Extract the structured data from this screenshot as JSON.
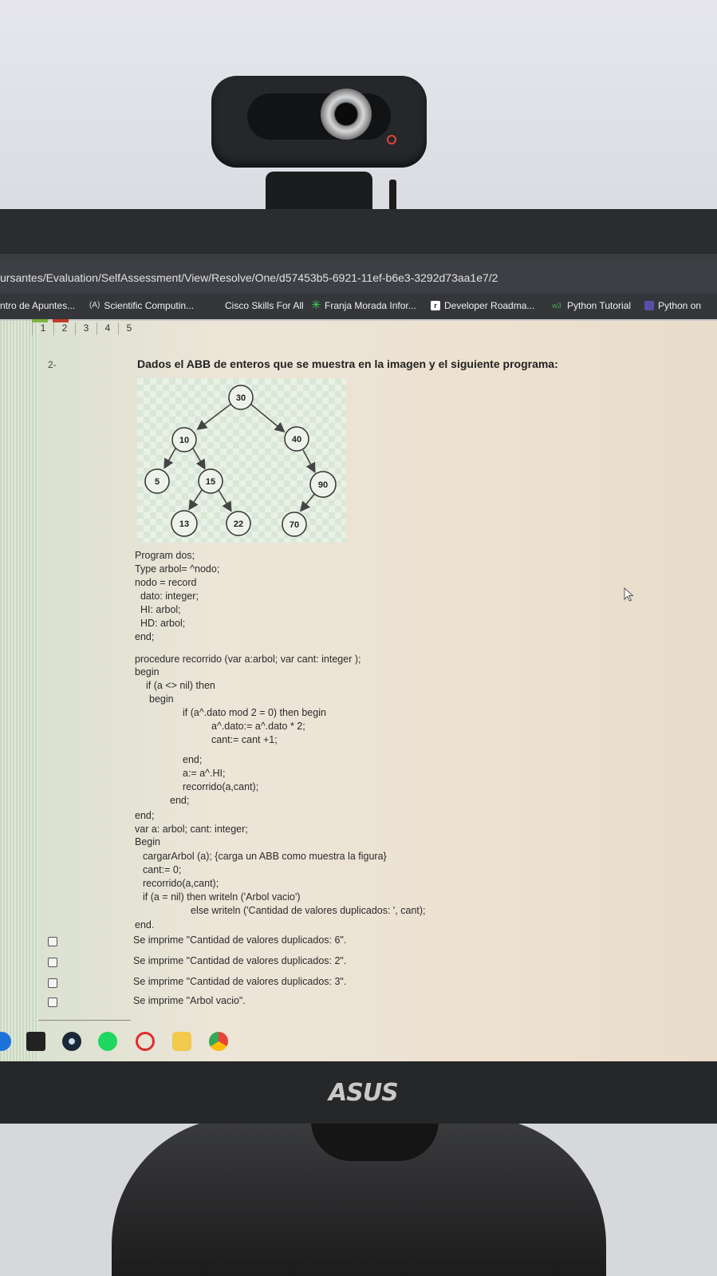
{
  "browser": {
    "url": "ursantes/Evaluation/SelfAssessment/View/Resolve/One/d57453b5-6921-11ef-b6e3-3292d73aa1e7/2",
    "bookmarks": [
      {
        "label": "ntro de Apuntes...",
        "icon": ""
      },
      {
        "label": "Scientific Computin...",
        "icon": "(A)"
      },
      {
        "label": "Cisco Skills For All",
        "icon": ""
      },
      {
        "label": "Franja Morada Infor...",
        "icon": "star-icon"
      },
      {
        "label": "Developer Roadma...",
        "icon": "r"
      },
      {
        "label": "Python Tutorial",
        "icon": "w3"
      },
      {
        "label": "Python on",
        "icon": "square-icon"
      }
    ]
  },
  "pagination": [
    "1",
    "2",
    "3",
    "4",
    "5"
  ],
  "question": {
    "number": "2-",
    "text": "Dados el ABB de enteros que se muestra en la imagen y el siguiente programa:"
  },
  "tree": {
    "nodes": [
      "30",
      "10",
      "40",
      "5",
      "15",
      "90",
      "13",
      "22",
      "70"
    ]
  },
  "code": [
    "Program dos;",
    "Type arbol= ^nodo;",
    "nodo = record",
    "  dato: integer;",
    "  HI: arbol;",
    "  HD: arbol;",
    "end;",
    "procedure recorrido (var a:arbol; var cant: integer );",
    "begin",
    "if (a <> nil) then",
    "begin",
    "if (a^.dato mod 2 = 0) then begin",
    "a^.dato:= a^.dato * 2;",
    "cant:= cant +1;",
    "end;",
    "a:= a^.HI;",
    "recorrido(a,cant);",
    "end;",
    "end;",
    "var a: arbol; cant: integer;",
    "Begin",
    "cargarArbol (a); {carga un ABB como muestra la figura}",
    "cant:= 0;",
    "recorrido(a,cant);",
    "if (a = nil) then writeln ('Arbol vacio')",
    "else writeln ('Cantidad de valores duplicados: ', cant);",
    "end."
  ],
  "options": [
    "Se imprime \"Cantidad de valores duplicados: 6\".",
    "Se imprime \"Cantidad de valores duplicados: 2\".",
    "Se imprime \"Cantidad de valores duplicados: 3\".",
    "Se imprime \"Arbol vacio\"."
  ],
  "monitor": {
    "brand": "ASUS"
  },
  "colors": {
    "accent_red": "#c0392b",
    "node_fill": "#eef3ea"
  }
}
